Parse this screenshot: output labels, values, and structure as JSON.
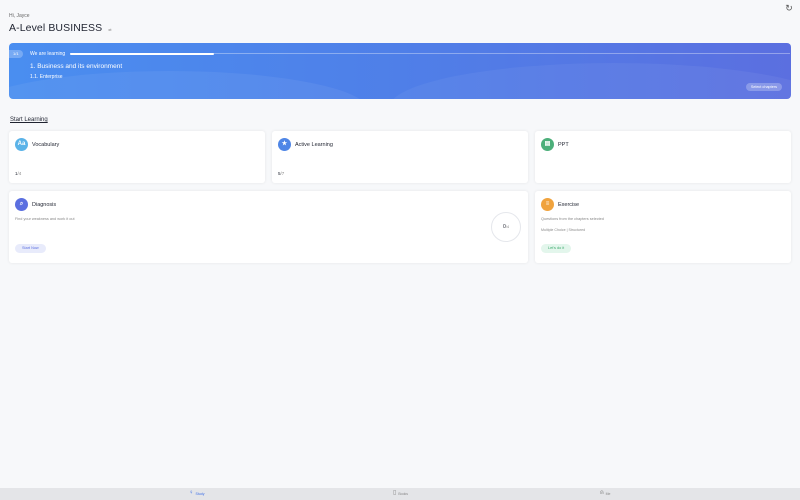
{
  "header": {
    "greeting": "Hi, Jayce",
    "course_title": "A-Level BUSINESS",
    "switch_icon": "swap-icon",
    "refresh_icon": "refresh-icon"
  },
  "banner": {
    "counter": "1/1",
    "learning_label": "We are learning",
    "progress_fraction": 0.2,
    "chapter": "1. Business and its environment",
    "section": "1.1. Enterprise",
    "select_button": "Select chapters",
    "colors": {
      "start": "#4a8ef0",
      "end": "#5b6fe0"
    }
  },
  "start_learning": "Start Learning",
  "cards": {
    "vocabulary": {
      "title": "Vocabulary",
      "icon_text": "Aa",
      "done": "1",
      "total": "/4",
      "color": "#5bb3e8"
    },
    "active_learning": {
      "title": "Active Learning",
      "icon": "star-icon",
      "done": "5",
      "total": "/7",
      "color": "#4f86e6"
    },
    "ppt": {
      "title": "PPT",
      "icon": "document-icon",
      "color": "#4caf7a"
    },
    "diagnosis": {
      "title": "Diagnosis",
      "icon": "search-icon",
      "desc": "Find your weakness and work it out",
      "button": "Start Now",
      "done": "0",
      "total": "/4",
      "color": "#5b6fe0"
    },
    "exercise": {
      "title": "Exercise",
      "icon": "stack-icon",
      "desc": "Questions from the chapters selected",
      "tags": "Multiple Choice  |  Structured",
      "button": "Let's do it",
      "color": "#f0a33e"
    }
  },
  "tabbar": {
    "items": [
      {
        "label": "Study",
        "icon": "bulb-icon",
        "active": true
      },
      {
        "label": "Books",
        "icon": "book-icon",
        "active": false
      },
      {
        "label": "Me",
        "icon": "user-icon",
        "active": false
      }
    ]
  }
}
